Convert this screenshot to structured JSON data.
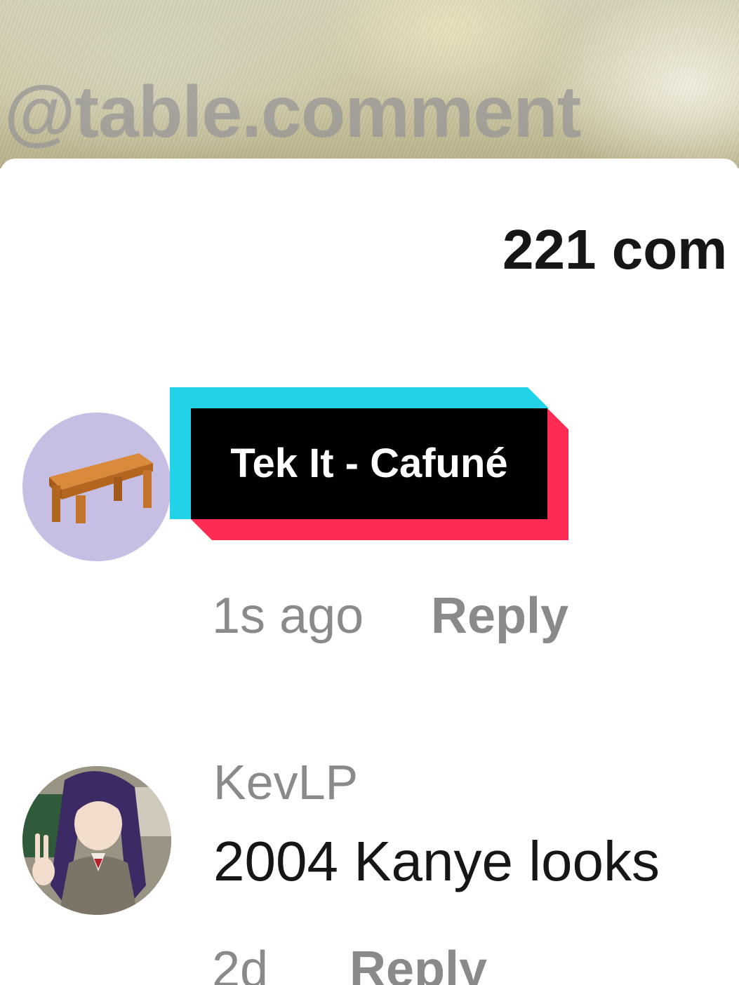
{
  "video": {
    "watermark": "@table.comment"
  },
  "comments_sheet": {
    "title": "221 com"
  },
  "overlay": {
    "music_label": "Tek It - Cafuné"
  },
  "comments": [
    {
      "avatar_icon": "table-icon",
      "timestamp": "1s ago",
      "reply_label": "Reply"
    },
    {
      "username": "KevLP",
      "text": "2004 Kanye looks",
      "timestamp": "2d",
      "reply_label": "Reply",
      "avatar_icon": "anime-character-avatar"
    }
  ],
  "colors": {
    "sticker_cyan": "#22d3e8",
    "sticker_red": "#fe2c55",
    "sticker_black": "#000000",
    "muted_text": "#8a8a8a",
    "primary_text": "#161616"
  }
}
